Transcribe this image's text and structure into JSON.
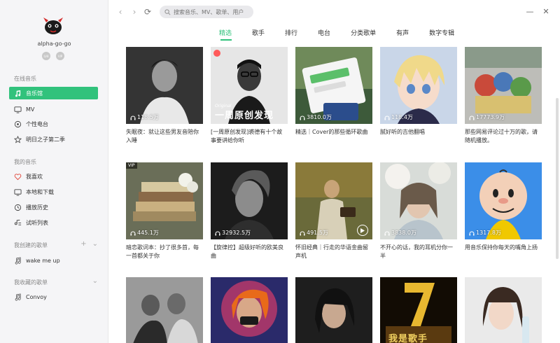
{
  "user": {
    "name": "alpha-go-go",
    "badge_1": "LV8",
    "badge_2": "VIP"
  },
  "sidebar": {
    "online_title": "在线音乐",
    "online_items": [
      {
        "label": "音乐馆",
        "icon": "music-note-icon",
        "active": true
      },
      {
        "label": "MV",
        "icon": "monitor-icon"
      },
      {
        "label": "个性电台",
        "icon": "radio-icon"
      },
      {
        "label": "明日之子第二季",
        "icon": "star-icon"
      }
    ],
    "my_title": "我的音乐",
    "my_items": [
      {
        "label": "我喜欢",
        "icon": "heart-icon"
      },
      {
        "label": "本地和下载",
        "icon": "monitor-icon"
      },
      {
        "label": "播放历史",
        "icon": "clock-icon"
      },
      {
        "label": "试听列表",
        "icon": "list-icon"
      }
    ],
    "created_title": "我创建的歌单",
    "created_add": "+",
    "created_toggle": "⌄",
    "created_items": [
      {
        "label": "wake me up",
        "icon": "music-note-icon"
      }
    ],
    "collected_title": "我收藏的歌单",
    "collected_toggle": "⌄",
    "collected_items": [
      {
        "label": "Convoy",
        "icon": "music-note-icon"
      }
    ]
  },
  "topbar": {
    "back": "‹",
    "forward": "›",
    "refresh": "⟳",
    "search_placeholder": "搜索音乐、MV、歌单、用户",
    "minimize": "—",
    "close": "✕"
  },
  "tabs": [
    "精选",
    "歌手",
    "排行",
    "电台",
    "分类歌单",
    "有声",
    "数字专辑"
  ],
  "accent_color": "#31c27c",
  "playlists": [
    {
      "plays": "118.5万",
      "title": "失眠夜：就让这些男友音陪你入睡"
    },
    {
      "plays": "",
      "title": "[一周原创发现]裘德有十个故事要讲给你听",
      "overlay_en": "Original",
      "overlay_cn": "一周原创发现"
    },
    {
      "plays": "3810.0万",
      "title": "精选｜Cover的那些循环歌曲"
    },
    {
      "plays": "118.4万",
      "title": "腻好听的吉他翻唱"
    },
    {
      "plays": "17773.9万",
      "title": "那些网易评论过十万的歌，请随机播放。"
    },
    {
      "plays": "445.1万",
      "title": "暗恋歌词本：抄了很多首，每一首都关于你",
      "vip": "VIP"
    },
    {
      "plays": "32932.5万",
      "title": "【旋律控】超级好听的欧美良曲"
    },
    {
      "plays": "491.5万",
      "title": "怀旧经典｜行走的华语金曲留声机"
    },
    {
      "plays": "3838.0万",
      "title": "不开心的话，我的耳机分你一半"
    },
    {
      "plays": "1317.8万",
      "title": "用音乐保持你每天的嘴角上扬"
    },
    {
      "plays": "",
      "title": ""
    },
    {
      "plays": "",
      "title": ""
    },
    {
      "plays": "",
      "title": ""
    },
    {
      "plays": "",
      "title": "",
      "overlay_cn": "我是歌手"
    },
    {
      "plays": "",
      "title": ""
    }
  ]
}
